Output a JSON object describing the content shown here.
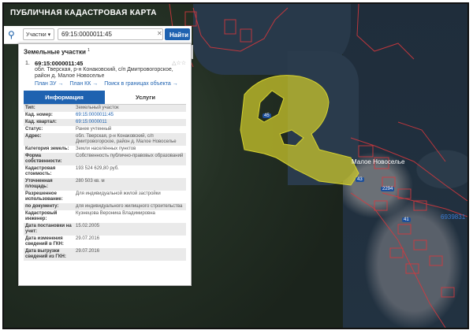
{
  "app": {
    "title": "ПУБЛИЧНАЯ КАДАСТРОВАЯ КАРТА"
  },
  "search": {
    "type_label": "Участки",
    "value": "69:15:0000011:45",
    "button": "Найти"
  },
  "panel": {
    "heading": "Земельные участки",
    "count": "1",
    "item": {
      "number": "1.",
      "title": "69:15:0000011:45",
      "address": "обл. Тверская, р-н Конаковский, с/п Дмитровогорское, район д. Малое Новоселье",
      "links": [
        "План ЗУ →",
        "План КК →",
        "Поиск в границах объекта →"
      ]
    },
    "tabs": [
      "Информация",
      "Услуги"
    ],
    "fields": [
      {
        "key": "Тип:",
        "value": "Земельный участок"
      },
      {
        "key": "Кад. номер:",
        "value": "69:15:0000011:45",
        "link": true
      },
      {
        "key": "Кад. квартал:",
        "value": "69:15:0000011",
        "link": true
      },
      {
        "key": "Статус:",
        "value": "Ранее учтенный"
      },
      {
        "key": "Адрес:",
        "value": "обл. Тверская, р-н Конаковский, с/п Дмитровогорское, район д. Малое Новоселье"
      },
      {
        "key": "Категория земель:",
        "value": "Земли населённых пунктов"
      },
      {
        "key": "Форма собственности:",
        "value": "Собственность публично-правовых образований"
      },
      {
        "key": "Кадастровая стоимость:",
        "value": "193 524 629,80 руб."
      },
      {
        "key": "Уточненная площадь:",
        "value": "280 503 кв. м"
      },
      {
        "key": "Разрешенное использование:",
        "value": "Для индивидуальной жилой застройки"
      },
      {
        "key": "по документу:",
        "value": "для индивидуального жилищного строительства"
      },
      {
        "key": "Кадастровый инженер:",
        "value": "Кузнецова Вероника Владимировна"
      },
      {
        "key": "Дата постановки на учет:",
        "value": "15.02.2005"
      },
      {
        "key": "Дата изменения сведений в ГКН:",
        "value": "29.07.2016"
      },
      {
        "key": "Дата выгрузки сведений из ГКН:",
        "value": "29.07.2016"
      }
    ]
  },
  "map": {
    "village_label": "Малое Новоселье",
    "cad_label": "6939831",
    "parcel_labels": [
      "45",
      "43",
      "2294",
      "41"
    ],
    "colors": {
      "parcel_fill": "#c9c62b",
      "border": "#d8383d",
      "accent": "#1e62b0"
    }
  },
  "icons": {
    "search": "search-icon",
    "star": "star-icon",
    "close": "close-icon"
  }
}
